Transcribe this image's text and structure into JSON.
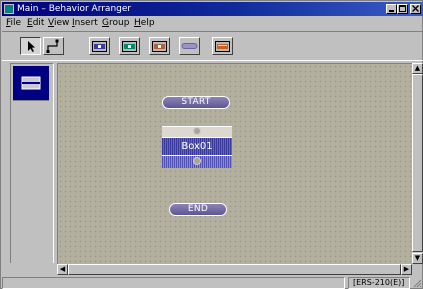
{
  "window": {
    "title": "Main – Behavior Arranger",
    "controls": [
      "minimize",
      "maximize",
      "close"
    ]
  },
  "menu": [
    {
      "label": "File",
      "underline": "F",
      "rest": "ile"
    },
    {
      "label": "Edit",
      "underline": "E",
      "rest": "dit"
    },
    {
      "label": "View",
      "underline": "V",
      "rest": "iew"
    },
    {
      "label": "Insert",
      "underline": "I",
      "rest": "nsert"
    },
    {
      "label": "Group",
      "underline": "G",
      "rest": "roup"
    },
    {
      "label": "Help",
      "underline": "H",
      "rest": "elp"
    }
  ],
  "toolbar": {
    "tools": [
      "select-arrow-icon",
      "connect-line-icon",
      "behavior-box-icon-1",
      "behavior-box-icon-2",
      "behavior-box-icon-3",
      "pill-node-icon",
      "behavior-box-icon-4"
    ],
    "selected_tool": "select-arrow-icon"
  },
  "canvas": {
    "start_label": "START",
    "end_label": "END",
    "box_label": "Box01"
  },
  "status": {
    "model": "[ERS-210(E)]"
  },
  "colors": {
    "titlebar": "#00007b",
    "canvas": "#b4b0a0",
    "node": "#6a62a4",
    "box": "#4848a8"
  }
}
